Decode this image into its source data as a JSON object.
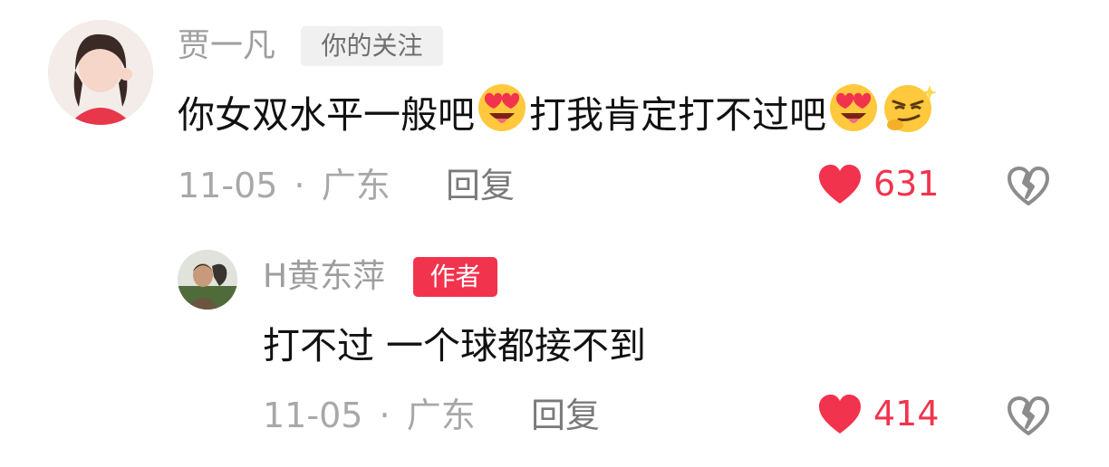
{
  "comments": [
    {
      "username": "贾一凡",
      "tag": "你的关注",
      "text_parts": [
        "你女双水平一般吧",
        "打我肯定打不过吧"
      ],
      "emojis": [
        "heart-eyes-emoji",
        "heart-eyes-emoji",
        "smirk-emoji"
      ],
      "date": "11-05",
      "separator": "·",
      "location": "广东",
      "reply_label": "回复",
      "like_count": "631"
    },
    {
      "username": "H黄东萍",
      "tag": "作者",
      "text": "打不过 一个球都接不到",
      "date": "11-05",
      "separator": "·",
      "location": "广东",
      "reply_label": "回复",
      "like_count": "414"
    }
  ],
  "colors": {
    "accent": "#f2334d",
    "muted_text": "#a8a8a8",
    "username": "#9e9e9e",
    "body_text": "#111111"
  },
  "icons": [
    "heart-icon",
    "broken-heart-icon"
  ]
}
